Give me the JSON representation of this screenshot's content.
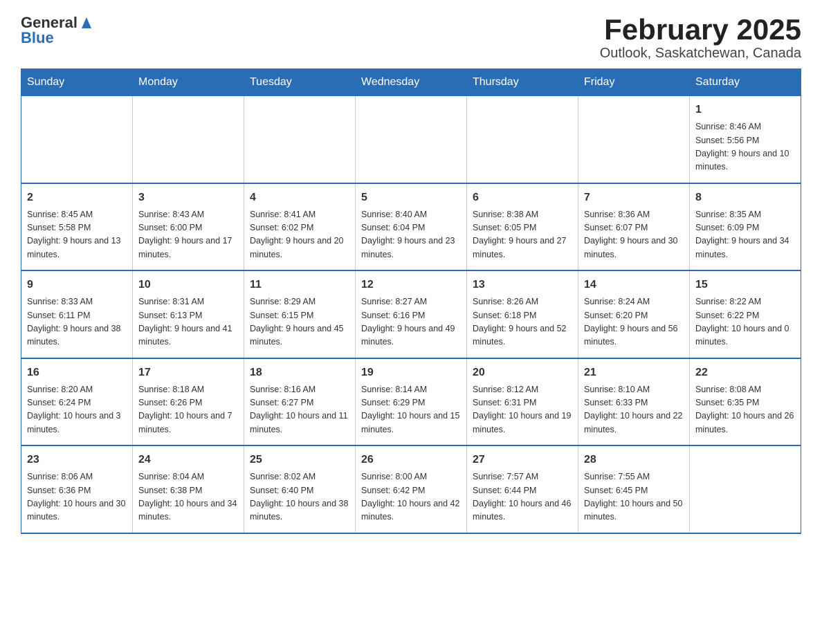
{
  "header": {
    "logo_general": "General",
    "logo_blue": "Blue",
    "title": "February 2025",
    "subtitle": "Outlook, Saskatchewan, Canada"
  },
  "days_of_week": [
    "Sunday",
    "Monday",
    "Tuesday",
    "Wednesday",
    "Thursday",
    "Friday",
    "Saturday"
  ],
  "weeks": [
    {
      "cells": [
        {
          "day": "",
          "info": ""
        },
        {
          "day": "",
          "info": ""
        },
        {
          "day": "",
          "info": ""
        },
        {
          "day": "",
          "info": ""
        },
        {
          "day": "",
          "info": ""
        },
        {
          "day": "",
          "info": ""
        },
        {
          "day": "1",
          "info": "Sunrise: 8:46 AM\nSunset: 5:56 PM\nDaylight: 9 hours and 10 minutes."
        }
      ]
    },
    {
      "cells": [
        {
          "day": "2",
          "info": "Sunrise: 8:45 AM\nSunset: 5:58 PM\nDaylight: 9 hours and 13 minutes."
        },
        {
          "day": "3",
          "info": "Sunrise: 8:43 AM\nSunset: 6:00 PM\nDaylight: 9 hours and 17 minutes."
        },
        {
          "day": "4",
          "info": "Sunrise: 8:41 AM\nSunset: 6:02 PM\nDaylight: 9 hours and 20 minutes."
        },
        {
          "day": "5",
          "info": "Sunrise: 8:40 AM\nSunset: 6:04 PM\nDaylight: 9 hours and 23 minutes."
        },
        {
          "day": "6",
          "info": "Sunrise: 8:38 AM\nSunset: 6:05 PM\nDaylight: 9 hours and 27 minutes."
        },
        {
          "day": "7",
          "info": "Sunrise: 8:36 AM\nSunset: 6:07 PM\nDaylight: 9 hours and 30 minutes."
        },
        {
          "day": "8",
          "info": "Sunrise: 8:35 AM\nSunset: 6:09 PM\nDaylight: 9 hours and 34 minutes."
        }
      ]
    },
    {
      "cells": [
        {
          "day": "9",
          "info": "Sunrise: 8:33 AM\nSunset: 6:11 PM\nDaylight: 9 hours and 38 minutes."
        },
        {
          "day": "10",
          "info": "Sunrise: 8:31 AM\nSunset: 6:13 PM\nDaylight: 9 hours and 41 minutes."
        },
        {
          "day": "11",
          "info": "Sunrise: 8:29 AM\nSunset: 6:15 PM\nDaylight: 9 hours and 45 minutes."
        },
        {
          "day": "12",
          "info": "Sunrise: 8:27 AM\nSunset: 6:16 PM\nDaylight: 9 hours and 49 minutes."
        },
        {
          "day": "13",
          "info": "Sunrise: 8:26 AM\nSunset: 6:18 PM\nDaylight: 9 hours and 52 minutes."
        },
        {
          "day": "14",
          "info": "Sunrise: 8:24 AM\nSunset: 6:20 PM\nDaylight: 9 hours and 56 minutes."
        },
        {
          "day": "15",
          "info": "Sunrise: 8:22 AM\nSunset: 6:22 PM\nDaylight: 10 hours and 0 minutes."
        }
      ]
    },
    {
      "cells": [
        {
          "day": "16",
          "info": "Sunrise: 8:20 AM\nSunset: 6:24 PM\nDaylight: 10 hours and 3 minutes."
        },
        {
          "day": "17",
          "info": "Sunrise: 8:18 AM\nSunset: 6:26 PM\nDaylight: 10 hours and 7 minutes."
        },
        {
          "day": "18",
          "info": "Sunrise: 8:16 AM\nSunset: 6:27 PM\nDaylight: 10 hours and 11 minutes."
        },
        {
          "day": "19",
          "info": "Sunrise: 8:14 AM\nSunset: 6:29 PM\nDaylight: 10 hours and 15 minutes."
        },
        {
          "day": "20",
          "info": "Sunrise: 8:12 AM\nSunset: 6:31 PM\nDaylight: 10 hours and 19 minutes."
        },
        {
          "day": "21",
          "info": "Sunrise: 8:10 AM\nSunset: 6:33 PM\nDaylight: 10 hours and 22 minutes."
        },
        {
          "day": "22",
          "info": "Sunrise: 8:08 AM\nSunset: 6:35 PM\nDaylight: 10 hours and 26 minutes."
        }
      ]
    },
    {
      "cells": [
        {
          "day": "23",
          "info": "Sunrise: 8:06 AM\nSunset: 6:36 PM\nDaylight: 10 hours and 30 minutes."
        },
        {
          "day": "24",
          "info": "Sunrise: 8:04 AM\nSunset: 6:38 PM\nDaylight: 10 hours and 34 minutes."
        },
        {
          "day": "25",
          "info": "Sunrise: 8:02 AM\nSunset: 6:40 PM\nDaylight: 10 hours and 38 minutes."
        },
        {
          "day": "26",
          "info": "Sunrise: 8:00 AM\nSunset: 6:42 PM\nDaylight: 10 hours and 42 minutes."
        },
        {
          "day": "27",
          "info": "Sunrise: 7:57 AM\nSunset: 6:44 PM\nDaylight: 10 hours and 46 minutes."
        },
        {
          "day": "28",
          "info": "Sunrise: 7:55 AM\nSunset: 6:45 PM\nDaylight: 10 hours and 50 minutes."
        },
        {
          "day": "",
          "info": ""
        }
      ]
    }
  ]
}
